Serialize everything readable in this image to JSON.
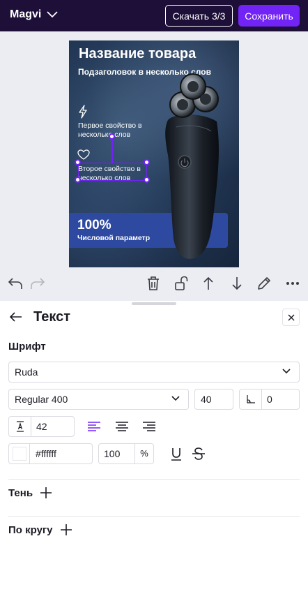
{
  "header": {
    "brand": "Magvi",
    "download_label": "Скачать 3/3",
    "save_label": "Сохранить"
  },
  "artboard": {
    "title": "Название товара",
    "subtitle": "Подзаголовок в несколько слов",
    "feature1": "Первое свойство в несколько слов",
    "feature2": "Второе свойство в несколько слов",
    "percent": "100%",
    "param": "Числовой параметр"
  },
  "toolbar": {
    "icons": [
      "undo-icon",
      "redo-icon",
      "trash-icon",
      "unlock-icon",
      "arrow-up-icon",
      "arrow-down-icon",
      "pencil-icon",
      "more-icon"
    ]
  },
  "panel": {
    "title": "Текст",
    "font_section": "Шрифт",
    "font_family": "Ruda",
    "font_weight": "Regular 400",
    "font_size": "40",
    "letter_spacing": "0",
    "line_height": "42",
    "color_hex": "#ffffff",
    "opacity": "100",
    "opacity_unit": "%",
    "shadow_label": "Тень",
    "circle_label": "По кругу"
  },
  "colors": {
    "header_bg": "#1d0f38",
    "accent": "#7223f5",
    "canvas_bg": "#ebedf2"
  }
}
